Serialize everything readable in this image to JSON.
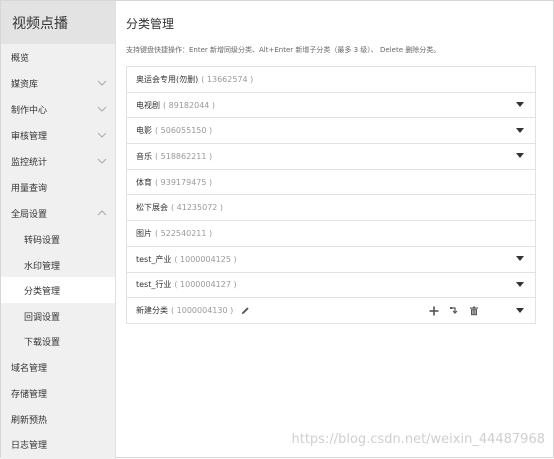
{
  "app": {
    "title": "视频点播"
  },
  "sidebar": {
    "items": [
      {
        "label": "概览"
      },
      {
        "label": "媒资库"
      },
      {
        "label": "制作中心"
      },
      {
        "label": "审核管理"
      },
      {
        "label": "监控统计"
      },
      {
        "label": "用量查询"
      },
      {
        "label": "全局设置"
      },
      {
        "label": "转码设置"
      },
      {
        "label": "水印管理"
      },
      {
        "label": "分类管理"
      },
      {
        "label": "回调设置"
      },
      {
        "label": "下载设置"
      },
      {
        "label": "域名管理"
      },
      {
        "label": "存储管理"
      },
      {
        "label": "刷新预热"
      },
      {
        "label": "日志管理"
      }
    ]
  },
  "main": {
    "title": "分类管理",
    "hint": "支持键盘快捷操作：Enter 新增同级分类、Alt+Enter 新增子分类（最多 3 级）、 Delete 删除分类。",
    "categories": [
      {
        "name": "奥运会专用(勿删)",
        "id": "( 13662574 )"
      },
      {
        "name": "电视剧",
        "id": "( 89182044 )"
      },
      {
        "name": "电影",
        "id": "( 506055150 )"
      },
      {
        "name": "音乐",
        "id": "( 518862211 )"
      },
      {
        "name": "体育",
        "id": "( 939179475 )"
      },
      {
        "name": "松下展会",
        "id": "( 41235072 )"
      },
      {
        "name": "图片",
        "id": "( 522540211 )"
      },
      {
        "name": "test_产业",
        "id": "( 1000004125 )"
      },
      {
        "name": "test_行业",
        "id": "( 1000004127 )"
      },
      {
        "name": "新建分类",
        "id": "( 1000004130 )"
      }
    ]
  },
  "watermark": "https://blog.csdn.net/weixin_44487968"
}
